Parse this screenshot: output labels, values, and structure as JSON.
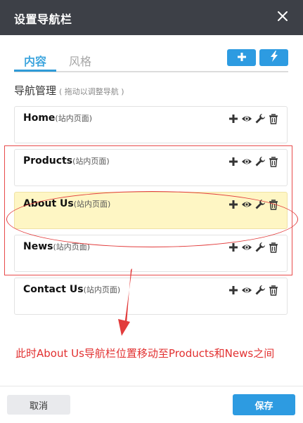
{
  "dialog": {
    "title": "设置导航栏"
  },
  "tabs": [
    {
      "label": "内容",
      "active": true
    },
    {
      "label": "风格",
      "active": false
    }
  ],
  "toolbar": {
    "add_icon": "plus-icon",
    "quick_icon": "lightning-icon"
  },
  "section": {
    "title": "导航管理",
    "hint": "( 拖动以调整导航 )"
  },
  "nav_items": [
    {
      "name": "Home",
      "type": "(站内页面)",
      "highlighted": false
    },
    {
      "name": "Products",
      "type": "(站内页面)",
      "highlighted": false
    },
    {
      "name": "About Us",
      "type": "(站内页面)",
      "highlighted": true
    },
    {
      "name": "News",
      "type": "(站内页面)",
      "highlighted": false
    },
    {
      "name": "Contact Us",
      "type": "(站内页面)",
      "highlighted": false
    }
  ],
  "item_actions": [
    "plus-icon",
    "eye-icon",
    "wrench-icon",
    "trash-icon"
  ],
  "annotation": {
    "text": "此时About Us导航栏位置移动至Products和News之间",
    "color": "#e23030"
  },
  "footer": {
    "cancel_label": "取消",
    "save_label": "保存"
  },
  "colors": {
    "titlebar": "#3d4047",
    "accent": "#2d9be1",
    "highlight": "#fef6c4",
    "annotation_red": "#e23c3c"
  }
}
